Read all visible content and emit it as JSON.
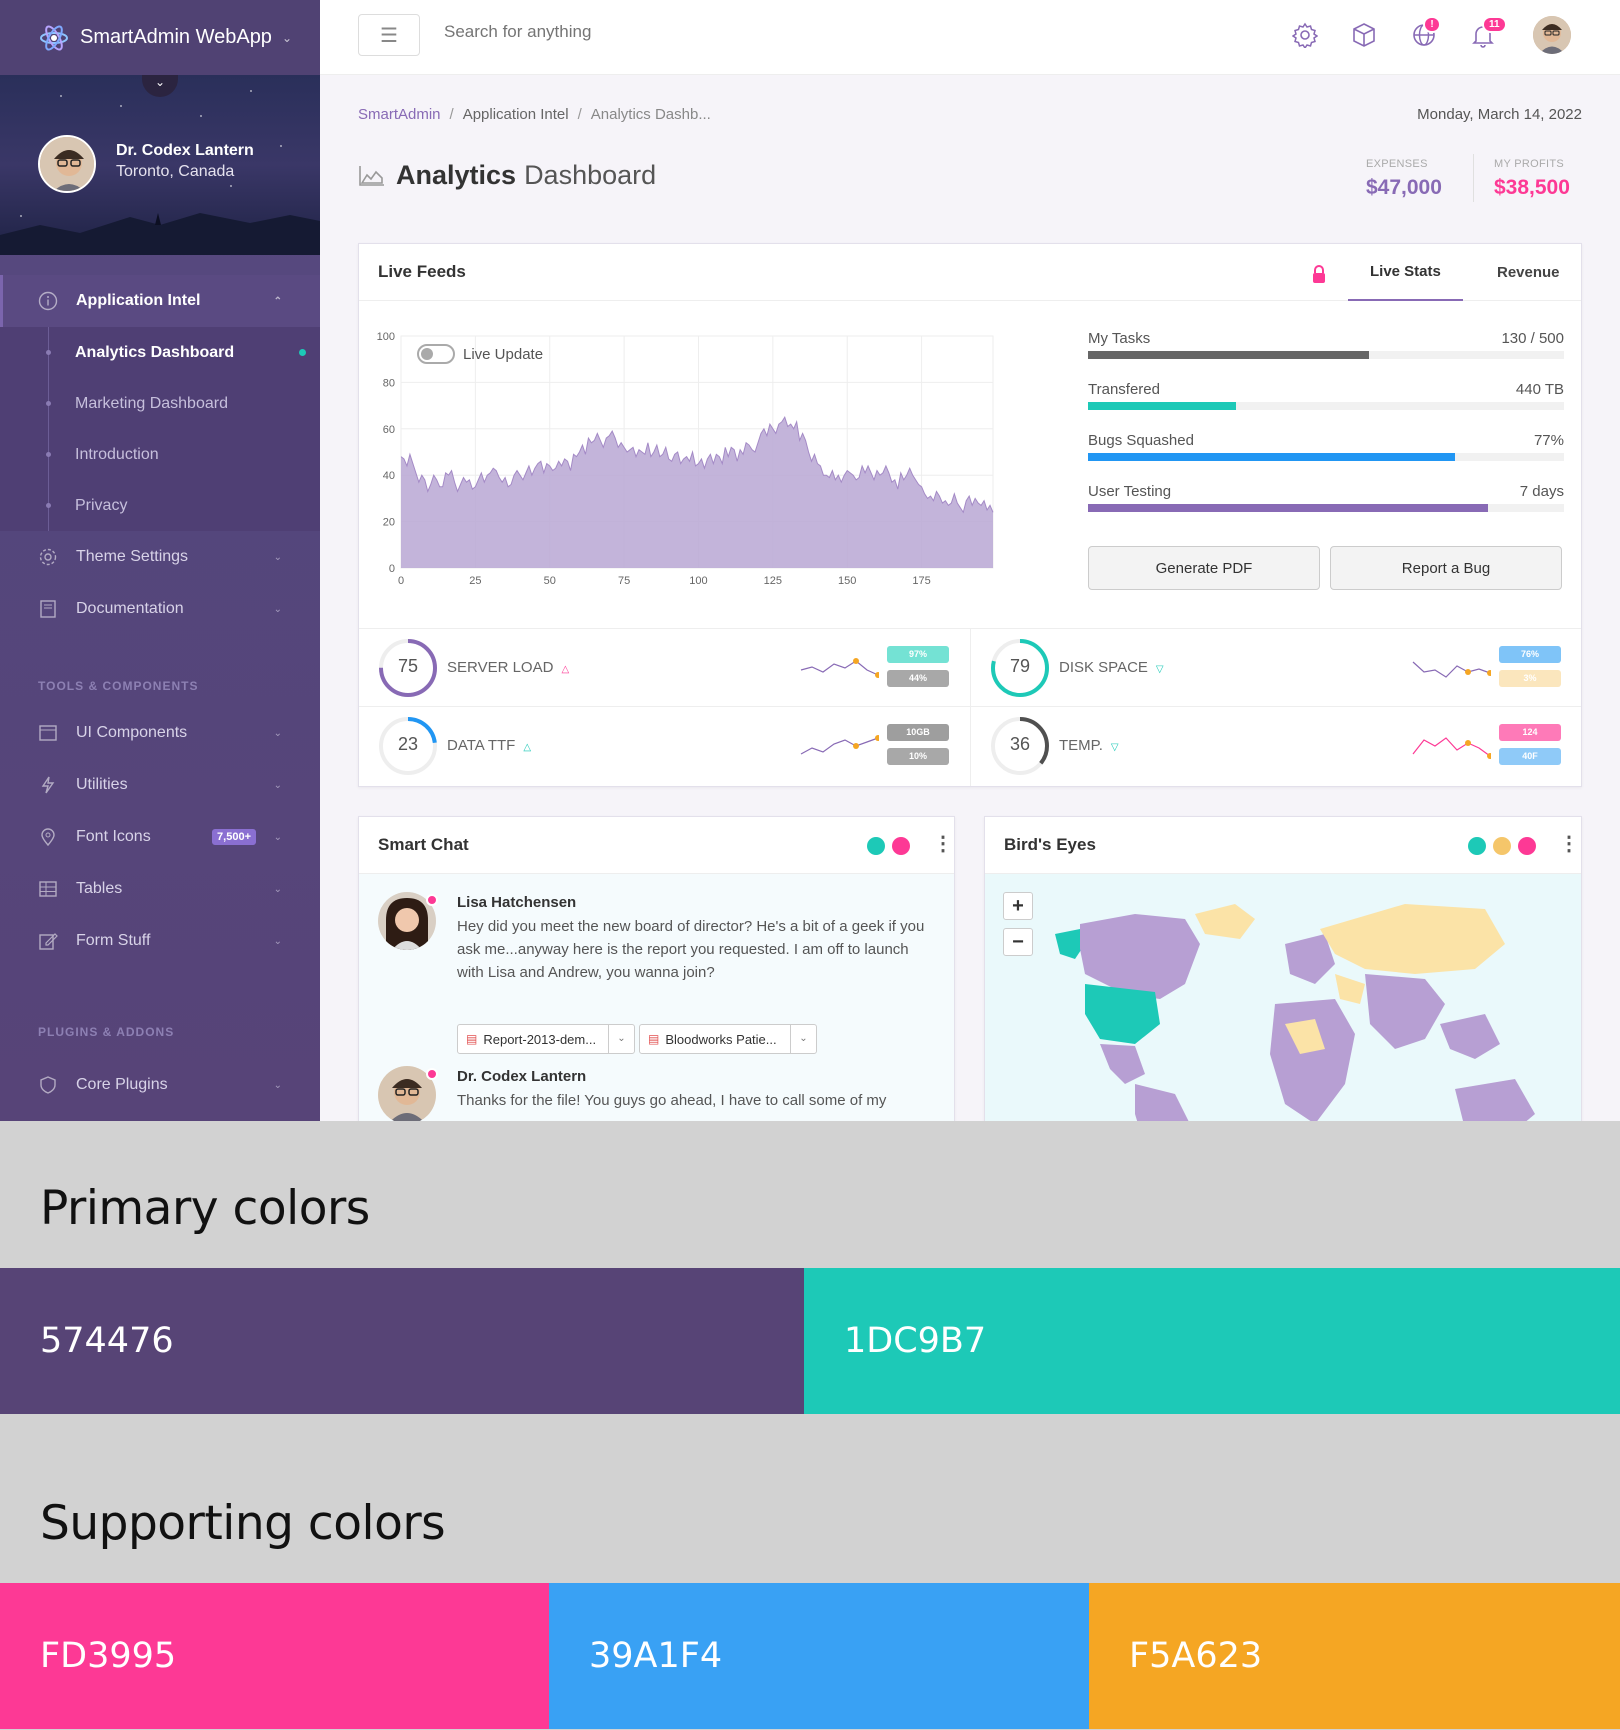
{
  "brand": {
    "name": "SmartAdmin WebApp"
  },
  "profile": {
    "name": "Dr. Codex Lantern",
    "location": "Toronto, Canada"
  },
  "nav": {
    "app_intel": "Application Intel",
    "sub": [
      "Analytics Dashboard",
      "Marketing Dashboard",
      "Introduction",
      "Privacy"
    ],
    "theme": "Theme Settings",
    "docs": "Documentation",
    "section_tools": "TOOLS & COMPONENTS",
    "ui": "UI Components",
    "utilities": "Utilities",
    "font_icons": "Font Icons",
    "font_icons_badge": "7,500+",
    "tables": "Tables",
    "form": "Form Stuff",
    "section_plugins": "PLUGINS & ADDONS",
    "core": "Core Plugins"
  },
  "topbar": {
    "search_placeholder": "Search for anything",
    "globe_badge": "!",
    "bell_badge": "11"
  },
  "breadcrumb": {
    "first": "SmartAdmin",
    "sep": "/",
    "second": "Application Intel",
    "third": "Analytics Dashb..."
  },
  "date": "Monday, March 14, 2022",
  "page": {
    "title_bold": "Analytics",
    "title_light": "Dashboard"
  },
  "stats": {
    "expenses_label": "EXPENSES",
    "expenses_value": "$47,000",
    "profits_label": "MY PROFITS",
    "profits_value": "$38,500"
  },
  "live_feeds": {
    "title": "Live Feeds",
    "tab_live": "Live Stats",
    "tab_revenue": "Revenue",
    "toggle_label": "Live Update",
    "buttons": {
      "pdf": "Generate PDF",
      "bug": "Report a Bug"
    },
    "progress": [
      {
        "label": "My Tasks",
        "value": "130 / 500",
        "pct": 0.59,
        "color": "#666666"
      },
      {
        "label": "Transfered",
        "value": "440 TB",
        "pct": 0.31,
        "color": "#1dc9b7"
      },
      {
        "label": "Bugs Squashed",
        "value": "77%",
        "pct": 0.77,
        "color": "#2196f3"
      },
      {
        "label": "User Testing",
        "value": "7 days",
        "pct": 0.84,
        "color": "#886ab5"
      }
    ],
    "kpis": [
      {
        "num": "75",
        "label": "SERVER LOAD",
        "pill1": "97%",
        "pill2": "44%",
        "ring_color": "#886ab5",
        "ring_pct": 0.75,
        "pill1_color": "#74e2d4",
        "pill2_color": "#a8a8a8"
      },
      {
        "num": "79",
        "label": "DISK SPACE",
        "pill1": "76%",
        "pill2": "3%",
        "ring_color": "#1dc9b7",
        "ring_pct": 0.79,
        "pill1_color": "#7fc4f8",
        "pill2_color": "#fbe6bd"
      },
      {
        "num": "23",
        "label": "DATA TTF",
        "pill1": "10GB",
        "pill2": "10%",
        "ring_color": "#2196f3",
        "ring_pct": 0.23,
        "pill1_color": "#9e9e9e",
        "pill2_color": "#a8a8a8"
      },
      {
        "num": "36",
        "label": "TEMP.",
        "pill1": "124",
        "pill2": "40F",
        "ring_color": "#505050",
        "ring_pct": 0.36,
        "pill1_color": "#fe7ab8",
        "pill2_color": "#8fcaf8"
      }
    ]
  },
  "chart_data": {
    "type": "area",
    "x_ticks": [
      "0",
      "25",
      "50",
      "75",
      "100",
      "125",
      "150",
      "175"
    ],
    "y_ticks": [
      "0",
      "20",
      "40",
      "60",
      "80",
      "100"
    ],
    "xlim": [
      0,
      199
    ],
    "ylim": [
      0,
      100
    ],
    "series": [
      {
        "values": [
          48,
          47,
          44,
          49,
          45,
          41,
          37,
          40,
          38,
          33,
          36,
          40,
          38,
          35,
          35,
          41,
          40,
          42,
          37,
          33,
          36,
          39,
          37,
          38,
          34,
          35,
          38,
          41,
          37,
          40,
          41,
          43,
          42,
          39,
          37,
          39,
          35,
          36,
          40,
          42,
          40,
          38,
          41,
          44,
          40,
          43,
          45,
          46,
          41,
          45,
          44,
          42,
          43,
          46,
          44,
          47,
          46,
          42,
          49,
          48,
          50,
          53,
          49,
          56,
          54,
          55,
          58,
          55,
          52,
          56,
          57,
          59,
          56,
          52,
          54,
          52,
          50,
          51,
          52,
          48,
          51,
          50,
          49,
          54,
          48,
          50,
          53,
          48,
          49,
          52,
          47,
          46,
          49,
          50,
          45,
          47,
          48,
          46,
          50,
          44,
          45,
          47,
          43,
          47,
          49,
          45,
          49,
          48,
          45,
          52,
          48,
          52,
          51,
          46,
          51,
          49,
          54,
          53,
          51,
          50,
          54,
          58,
          60,
          57,
          62,
          60,
          58,
          62,
          63,
          65,
          61,
          62,
          60,
          63,
          55,
          58,
          55,
          50,
          46,
          49,
          45,
          44,
          40,
          40,
          39,
          42,
          38,
          40,
          37,
          40,
          42,
          41,
          40,
          38,
          39,
          44,
          41,
          44,
          41,
          38,
          42,
          40,
          41,
          44,
          41,
          37,
          38,
          34,
          41,
          38,
          40,
          43,
          40,
          38,
          36,
          35,
          32,
          30,
          31,
          29,
          33,
          31,
          28,
          29,
          27,
          28,
          32,
          28,
          26,
          24,
          29,
          31,
          27,
          30,
          28,
          27,
          29,
          25,
          27,
          24
        ]
      }
    ],
    "color": "#b9a7d4"
  },
  "chat": {
    "title": "Smart Chat",
    "messages": [
      {
        "name": "Lisa Hatchensen",
        "text": "Hey did you meet the new board of director? He's a bit of a geek if you ask me...anyway here is the report you requested. I am off to launch with Lisa and Andrew, you wanna join?"
      },
      {
        "name": "Dr. Codex Lantern",
        "text": "Thanks for the file! You guys go ahead, I have to call some of my"
      }
    ],
    "attachments": [
      "Report-2013-dem...",
      "Bloodworks Patie..."
    ]
  },
  "map_panel": {
    "title": "Bird's Eyes",
    "zoom_in": "+",
    "zoom_out": "−"
  },
  "icons": [
    "gear-icon",
    "cube-icon",
    "globe-icon",
    "bell-icon",
    "lock-icon"
  ],
  "palette": {
    "primary_title": "Primary colors",
    "supporting_title": "Supporting colors",
    "primary": [
      {
        "hex": "574476",
        "color": "#574476"
      },
      {
        "hex": "1DC9B7",
        "color": "#1dc9b7"
      }
    ],
    "supporting": [
      {
        "hex": "FD3995",
        "color": "#fd3995"
      },
      {
        "hex": "39A1F4",
        "color": "#39a1f4"
      },
      {
        "hex": "F5A623",
        "color": "#f5a623"
      }
    ]
  }
}
